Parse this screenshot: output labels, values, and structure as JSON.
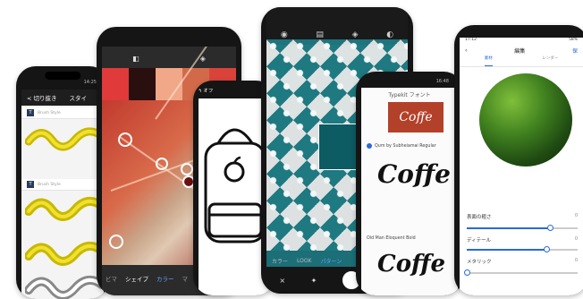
{
  "phone1": {
    "time": "14:25",
    "nav_back": "< 切り抜き",
    "nav_title": "スタイ",
    "rows": [
      {
        "badge": "T",
        "text": "Brush Style"
      },
      {
        "badge": "T",
        "text": "Brush Style"
      }
    ]
  },
  "phone2": {
    "swatches": [
      "#e03a3a",
      "#2a0f0f",
      "#f0a888",
      "#d26a4a",
      "#d9433a"
    ],
    "tabs": [
      "ビマ",
      "シェイプ",
      "カラー",
      "マ"
    ]
  },
  "phone3": {
    "left_status": "ϟ オフ",
    "right_icon": "camera-icon"
  },
  "phone4": {
    "top_icons": [
      "share-icon",
      "layers-icon",
      "target-icon",
      "brush-icon"
    ],
    "tabs": [
      "カラー",
      "LOOK",
      "パターン"
    ],
    "bottom_left": "×",
    "bottom_mid": "✦"
  },
  "phone5": {
    "time": "16:48",
    "title": "Typekit フォント",
    "tile_text": "Coffe",
    "font1": "Qum by Subheiamai Regular",
    "script1": "Coffe",
    "font2": "Old Man Eloquent Bold",
    "script2": "Coffe"
  },
  "phone6": {
    "time": "17:12",
    "battery": "58%",
    "title": "編集",
    "done": "保",
    "tabs": [
      "素材",
      "レンダー"
    ],
    "sliders": [
      {
        "label": "表面の粗さ",
        "value": 0.75,
        "readout": "0"
      },
      {
        "label": "ディテール",
        "value": 0.72,
        "readout": "0"
      },
      {
        "label": "メタリック",
        "value": 0.0,
        "readout": "0"
      }
    ]
  }
}
